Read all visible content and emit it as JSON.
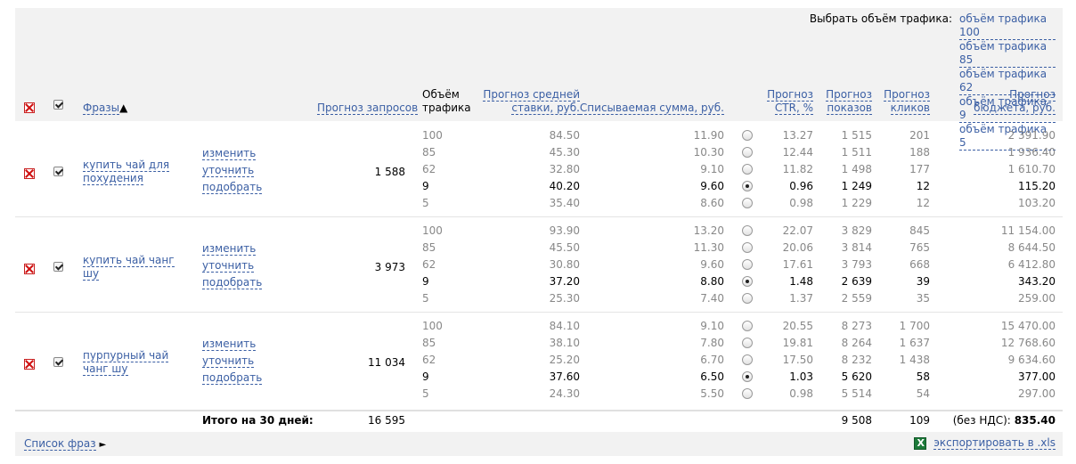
{
  "traffic_selector": {
    "label": "Выбрать объём трафика:",
    "options": [
      "объём трафика 100",
      "объём трафика 85",
      "объём трафика 62",
      "объём трафика 9",
      "объём трафика 5"
    ]
  },
  "columns": {
    "phrases": "Фразы",
    "sort_arrow": "▲",
    "requests": "Прогноз запросов",
    "volume_line1": "Объём",
    "volume_line2": "трафика",
    "bid_line1": "Прогноз средней",
    "bid_line2": "ставки, руб.",
    "charged": "Списываемая сумма, руб.",
    "ctr_line1": "Прогноз",
    "ctr_line2": "CTR, %",
    "shows_line1": "Прогноз",
    "shows_line2": "показов",
    "clicks_line1": "Прогноз",
    "clicks_line2": "кликов",
    "budget_line1": "Прогноз",
    "budget_line2": "бюджета, руб."
  },
  "row_actions": [
    "изменить",
    "уточнить",
    "подобрать"
  ],
  "phrases": [
    {
      "name_line1": "купить чай для",
      "name_line2": "похудения",
      "requests": "1 588",
      "rows": [
        {
          "vol": "100",
          "bid": "84.50",
          "charge": "11.90",
          "ctr": "13.27",
          "shows": "1 515",
          "clicks": "201",
          "budget": "2 391.90"
        },
        {
          "vol": "85",
          "bid": "45.30",
          "charge": "10.30",
          "ctr": "12.44",
          "shows": "1 511",
          "clicks": "188",
          "budget": "1 936.40"
        },
        {
          "vol": "62",
          "bid": "32.80",
          "charge": "9.10",
          "ctr": "11.82",
          "shows": "1 498",
          "clicks": "177",
          "budget": "1 610.70"
        },
        {
          "vol": "9",
          "bid": "40.20",
          "charge": "9.60",
          "ctr": "0.96",
          "shows": "1 249",
          "clicks": "12",
          "budget": "115.20"
        },
        {
          "vol": "5",
          "bid": "35.40",
          "charge": "8.60",
          "ctr": "0.98",
          "shows": "1 229",
          "clicks": "12",
          "budget": "103.20"
        }
      ],
      "selected": 3
    },
    {
      "name_line1": "купить чай чанг",
      "name_line2": "шу",
      "requests": "3 973",
      "rows": [
        {
          "vol": "100",
          "bid": "93.90",
          "charge": "13.20",
          "ctr": "22.07",
          "shows": "3 829",
          "clicks": "845",
          "budget": "11 154.00"
        },
        {
          "vol": "85",
          "bid": "45.50",
          "charge": "11.30",
          "ctr": "20.06",
          "shows": "3 814",
          "clicks": "765",
          "budget": "8 644.50"
        },
        {
          "vol": "62",
          "bid": "30.80",
          "charge": "9.60",
          "ctr": "17.61",
          "shows": "3 793",
          "clicks": "668",
          "budget": "6 412.80"
        },
        {
          "vol": "9",
          "bid": "37.20",
          "charge": "8.80",
          "ctr": "1.48",
          "shows": "2 639",
          "clicks": "39",
          "budget": "343.20"
        },
        {
          "vol": "5",
          "bid": "25.30",
          "charge": "7.40",
          "ctr": "1.37",
          "shows": "2 559",
          "clicks": "35",
          "budget": "259.00"
        }
      ],
      "selected": 3
    },
    {
      "name_line1": "пурпурный чай",
      "name_line2": "чанг шу",
      "requests": "11 034",
      "rows": [
        {
          "vol": "100",
          "bid": "84.10",
          "charge": "9.10",
          "ctr": "20.55",
          "shows": "8 273",
          "clicks": "1 700",
          "budget": "15 470.00"
        },
        {
          "vol": "85",
          "bid": "38.10",
          "charge": "7.80",
          "ctr": "19.81",
          "shows": "8 264",
          "clicks": "1 637",
          "budget": "12 768.60"
        },
        {
          "vol": "62",
          "bid": "25.20",
          "charge": "6.70",
          "ctr": "17.50",
          "shows": "8 232",
          "clicks": "1 438",
          "budget": "9 634.60"
        },
        {
          "vol": "9",
          "bid": "37.60",
          "charge": "6.50",
          "ctr": "1.03",
          "shows": "5 620",
          "clicks": "58",
          "budget": "377.00"
        },
        {
          "vol": "5",
          "bid": "24.30",
          "charge": "5.50",
          "ctr": "0.98",
          "shows": "5 514",
          "clicks": "54",
          "budget": "297.00"
        }
      ],
      "selected": 3
    }
  ],
  "totals": {
    "label": "Итого на 30 дней:",
    "requests": "16 595",
    "shows": "9 508",
    "clicks": "109",
    "vat_label": "(без НДС):",
    "budget": "835.40"
  },
  "footer": {
    "phrase_list": "Список фраз",
    "phrase_list_arrow": "►",
    "export": "экспортировать в .xls"
  },
  "colors": {
    "link": "#3b5fa4",
    "panel": "#f2f2f2",
    "muted_text": "#888888"
  }
}
